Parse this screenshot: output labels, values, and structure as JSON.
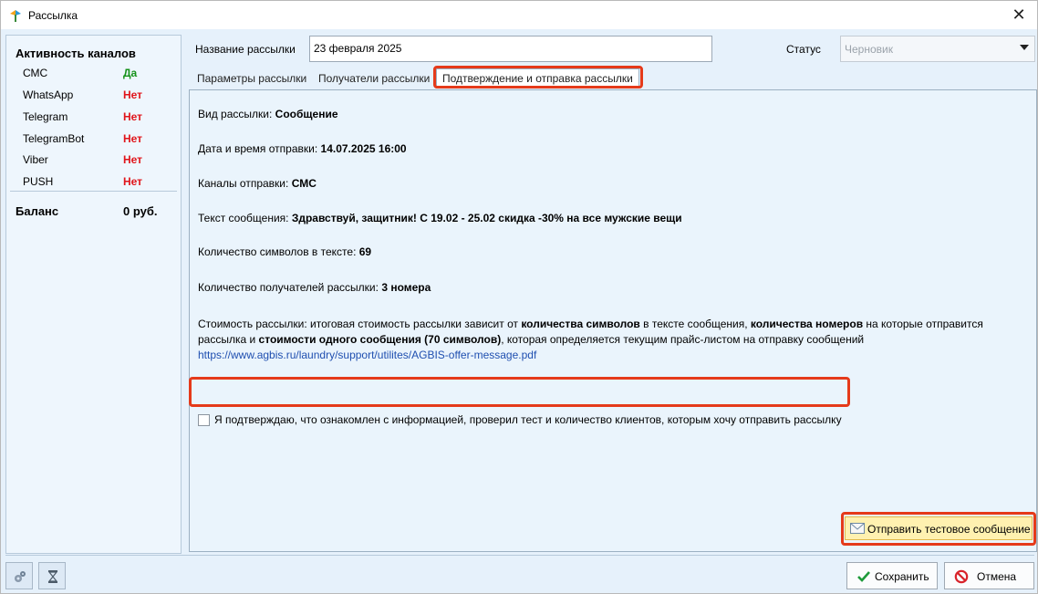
{
  "window": {
    "title": "Рассылка",
    "close_glyph": "✕"
  },
  "channels": {
    "heading": "Активность каналов",
    "items": [
      {
        "name": "СМС",
        "value": "Да",
        "active": true
      },
      {
        "name": "WhatsApp",
        "value": "Нет",
        "active": false
      },
      {
        "name": "Telegram",
        "value": "Нет",
        "active": false
      },
      {
        "name": "TelegramBot",
        "value": "Нет",
        "active": false
      },
      {
        "name": "Viber",
        "value": "Нет",
        "active": false
      },
      {
        "name": "PUSH",
        "value": "Нет",
        "active": false
      }
    ],
    "balance_label": "Баланс",
    "balance_value": "0 руб."
  },
  "form": {
    "name_label": "Название рассылки",
    "name_value": "23 февраля 2025",
    "status_label": "Статус",
    "status_value": "Черновик"
  },
  "tabs": [
    {
      "label": "Параметры рассылки"
    },
    {
      "label": "Получатели рассылки"
    },
    {
      "label": "Подтверждение и отправка рассылки",
      "active": true
    }
  ],
  "summary": {
    "type_label": "Вид рассылки:",
    "type_value": "Сообщение",
    "datetime_label": "Дата и время отправки:",
    "datetime_value": "14.07.2025 16:00",
    "channels_label": "Каналы отправки:",
    "channels_value": "СМС",
    "text_label": "Текст сообщения:",
    "text_value": "Здравствуй, защитник! С 19.02 - 25.02 скидка -30% на все мужские вещи",
    "chars_label": "Количество символов в тексте:",
    "chars_value": "69",
    "recipients_label": "Количество получателей рассылки:",
    "recipients_value": "3 номера",
    "cost_p1": "Стоимость рассылки: итоговая стоимость рассылки зависит от ",
    "cost_b1": "количества символов",
    "cost_p2": " в тексте сообщения, ",
    "cost_b2": "количества номеров",
    "cost_p3": " на которые отправится рассылка и ",
    "cost_b3": "стоимости одного сообщения (70 символов)",
    "cost_p4": ", которая определяется текущим прайс-листом на отправку сообщений",
    "cost_link": "https://www.agbis.ru/laundry/support/utilites/AGBIS-offer-message.pdf",
    "confirm_text": "Я подтверждаю, что ознакомлен с информацией, проверил тест и количество клиентов, которым хочу отправить рассылку",
    "confirm_checked": false
  },
  "buttons": {
    "test": "Отправить тестовое сообщение",
    "save": "Сохранить",
    "cancel": "Отмена"
  },
  "icons": {
    "app": "app-logo-icon",
    "test": "envelope-icon",
    "save": "checkmark-icon",
    "cancel": "cancel-icon",
    "tool1": "gears-icon",
    "tool2": "hourglass-icon"
  },
  "colors": {
    "yes": "#15921a",
    "no": "#e0141a",
    "highlight": "#e53a1a",
    "link": "#1f4fb0",
    "test_button": "#fff1b0"
  }
}
